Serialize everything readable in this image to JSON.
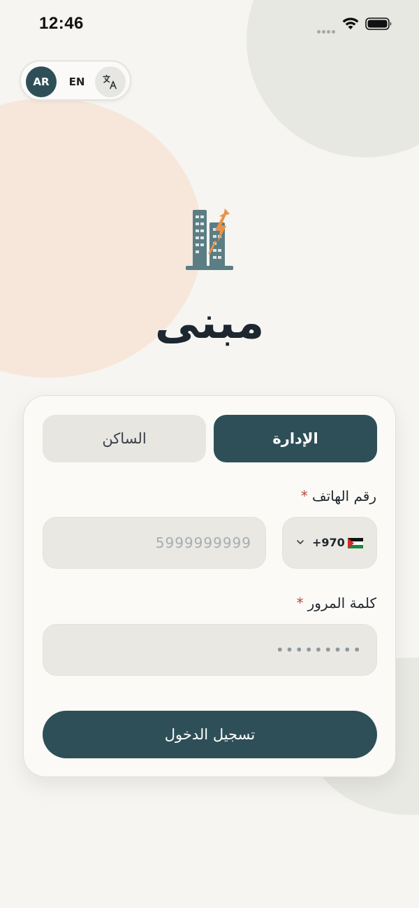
{
  "status_bar": {
    "time": "12:46"
  },
  "language_switch": {
    "ar_label": "AR",
    "en_label": "EN",
    "translate_icon": "translate-icon",
    "active": "AR"
  },
  "brand": {
    "logo_icon": "building-bolt-icon",
    "title": "مبنى"
  },
  "login_card": {
    "tabs": [
      {
        "label": "الإدارة",
        "selected": true
      },
      {
        "label": "الساكن",
        "selected": false
      }
    ],
    "phone": {
      "label": "رقم الهاتف",
      "required_mark": "*",
      "country_code": "+970",
      "country_flag": "palestine-flag-icon",
      "placeholder": "5999999999",
      "value": ""
    },
    "password": {
      "label": "كلمة المرور",
      "required_mark": "*",
      "placeholder": "•••••••••",
      "value": ""
    },
    "submit_label": "تسجيل الدخول"
  },
  "colors": {
    "primary": "#2e4f57",
    "background": "#f6f5f1",
    "required": "#b44a3c",
    "accent": "#e8934a"
  }
}
